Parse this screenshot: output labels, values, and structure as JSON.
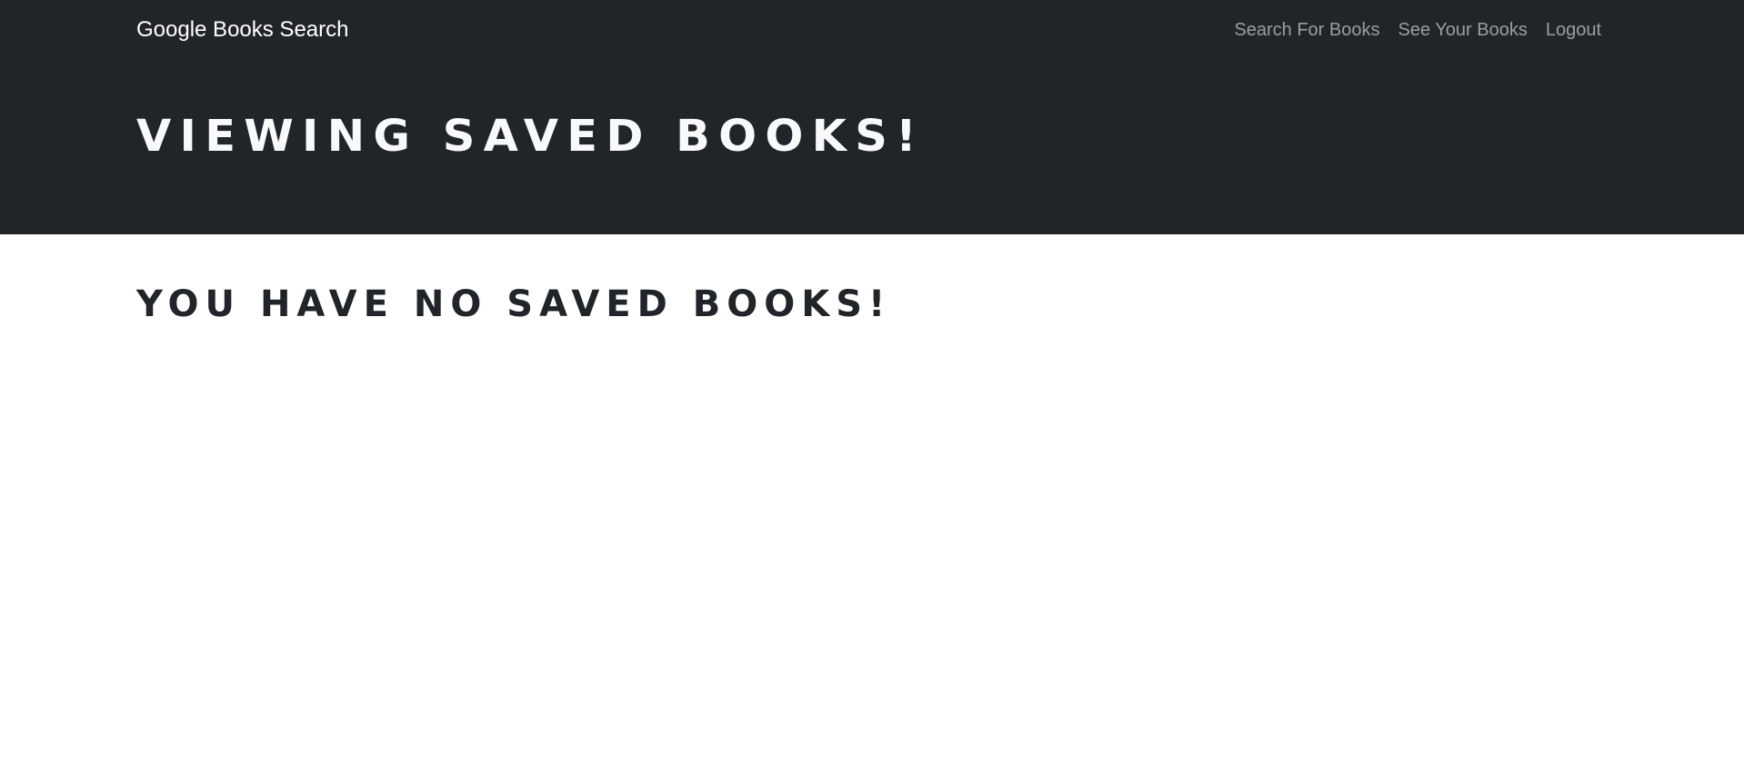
{
  "navbar": {
    "brand": "Google Books Search",
    "links": [
      {
        "label": "Search For Books"
      },
      {
        "label": "See Your Books"
      },
      {
        "label": "Logout"
      }
    ]
  },
  "hero": {
    "title": "Viewing saved books!"
  },
  "main": {
    "empty_message": "You have no saved books!"
  },
  "colors": {
    "navbar_bg": "#212529",
    "hero_text": "#f8f9fa",
    "nav_link": "#a6a7a9",
    "body_text": "#212529"
  }
}
